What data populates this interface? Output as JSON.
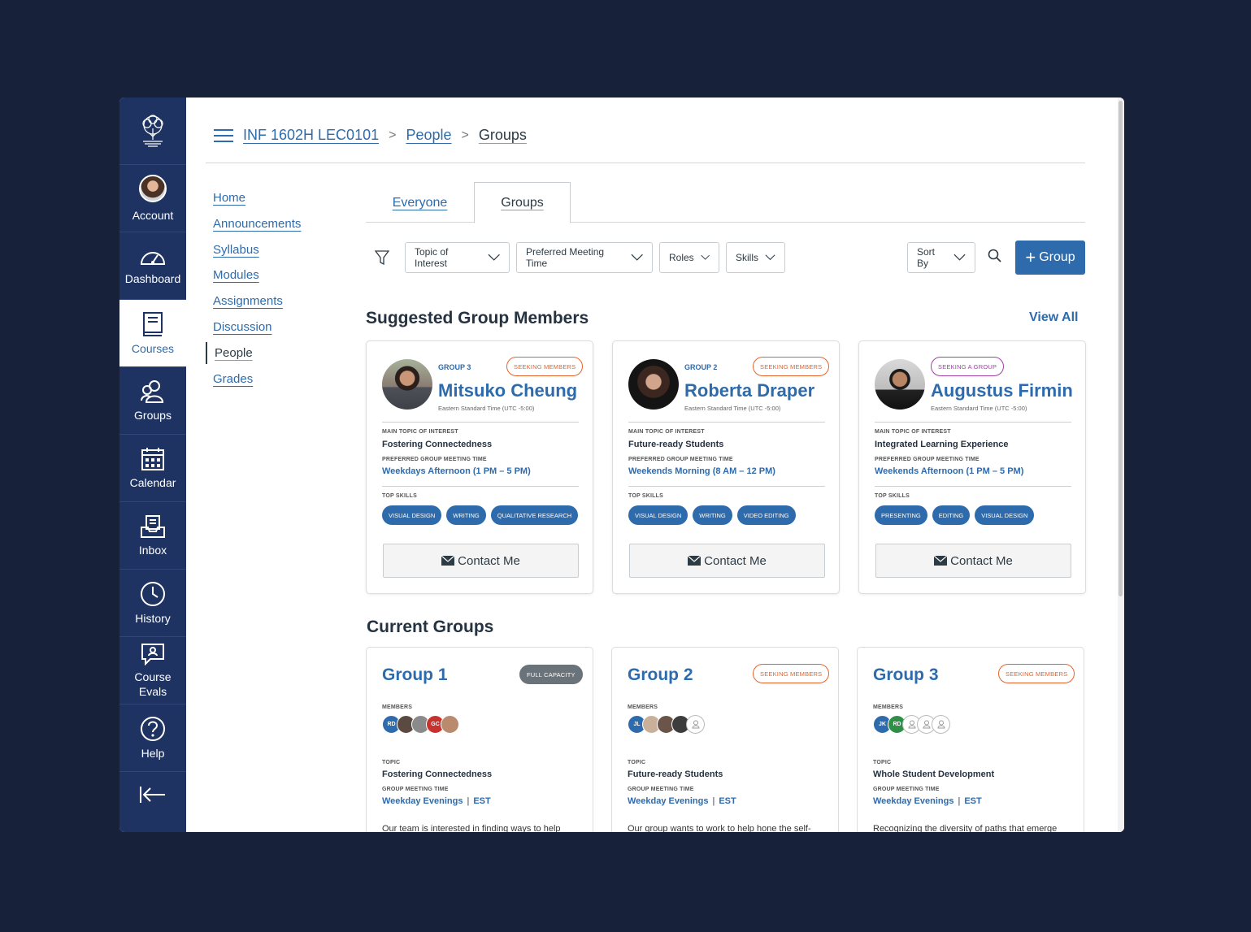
{
  "nav": {
    "account": "Account",
    "dashboard": "Dashboard",
    "courses": "Courses",
    "groups": "Groups",
    "calendar": "Calendar",
    "inbox": "Inbox",
    "history": "History",
    "course_evals_1": "Course",
    "course_evals_2": "Evals",
    "help": "Help"
  },
  "breadcrumb": {
    "course": "INF 1602H LEC0101",
    "people": "People",
    "current": "Groups",
    "separator": ">"
  },
  "course_nav": [
    "Home",
    "Announcements",
    "Syllabus",
    "Modules",
    "Assignments",
    "Discussion",
    "People",
    "Grades"
  ],
  "tabs": {
    "everyone": "Everyone",
    "groups": "Groups"
  },
  "filters": {
    "topic": "Topic of Interest",
    "time": "Preferred Meeting Time",
    "roles": "Roles",
    "skills": "Skills",
    "sort": "Sort By",
    "add_group": "Group",
    "add_plus": "+"
  },
  "suggested": {
    "title": "Suggested Group Members",
    "view_all": "View All",
    "labels": {
      "topic": "MAIN TOPIC  OF INTEREST",
      "topic_alt": "MAIN TOPIC OF INTEREST",
      "time": "PREFERRED GROUP MEETING TIME",
      "skills": "TOP SKILLS",
      "contact": "Contact Me"
    },
    "members": [
      {
        "group": "GROUP 3",
        "badge": "SEEKING MEMBERS",
        "name": "Mitsuko Cheung",
        "tz": "Eastern Standard Time (UTC -5:00)",
        "topic": "Fostering Connectedness",
        "time": "Weekdays Afternoon (1 PM – 5 PM)",
        "skills": [
          "VISUAL DESIGN",
          "WRITING",
          "QUALITATIVE RESEARCH"
        ]
      },
      {
        "group": "GROUP 2",
        "badge": "SEEKING MEMBERS",
        "name": "Roberta Draper",
        "tz": "Eastern Standard Time (UTC -5:00)",
        "topic": "Future-ready Students",
        "time": "Weekends Morning (8 AM – 12 PM)",
        "skills": [
          "VISUAL DESIGN",
          "WRITING",
          "VIDEO EDITING"
        ]
      },
      {
        "group": "",
        "badge": "SEEKING A GROUP",
        "name": "Augustus Firmin",
        "tz": "Eastern Standard Time (UTC -5:00)",
        "topic": "Integrated Learning Experience",
        "time": "Weekends Afternoon (1 PM – 5 PM)",
        "skills": [
          "PRESENTING",
          "EDITING",
          "VISUAL DESIGN"
        ]
      }
    ]
  },
  "current": {
    "title": "Current Groups",
    "labels": {
      "members": "MEMBERS",
      "topic": "TOPIC",
      "time": "GROUP MEETING TIME"
    },
    "groups": [
      {
        "name": "Group 1",
        "badge": "FULL CAPACITY",
        "initials": [
          "RD",
          "GC"
        ],
        "topic": "Fostering Connectedness",
        "time": "Weekday Evenings",
        "tz": "EST",
        "desc": "Our team is interested in finding ways to help"
      },
      {
        "name": "Group 2",
        "badge": "SEEKING MEMBERS",
        "initials": [
          "JL"
        ],
        "topic": "Future-ready Students",
        "time": "Weekday Evenings",
        "tz": "EST",
        "desc": "Our group wants to work to help hone the self-"
      },
      {
        "name": "Group 3",
        "badge": "SEEKING MEMBERS",
        "initials": [
          "JK",
          "RD"
        ],
        "topic": "Whole Student Development",
        "time": "Weekday Evenings",
        "tz": "EST",
        "desc": "Recognizing the diversity of paths that emerge"
      }
    ]
  },
  "colors": {
    "primary": "#2e6bad",
    "rail": "#1e3361",
    "seeking": "#e6622b",
    "seeking_group": "#a23ea8",
    "full": "#6b737a"
  }
}
